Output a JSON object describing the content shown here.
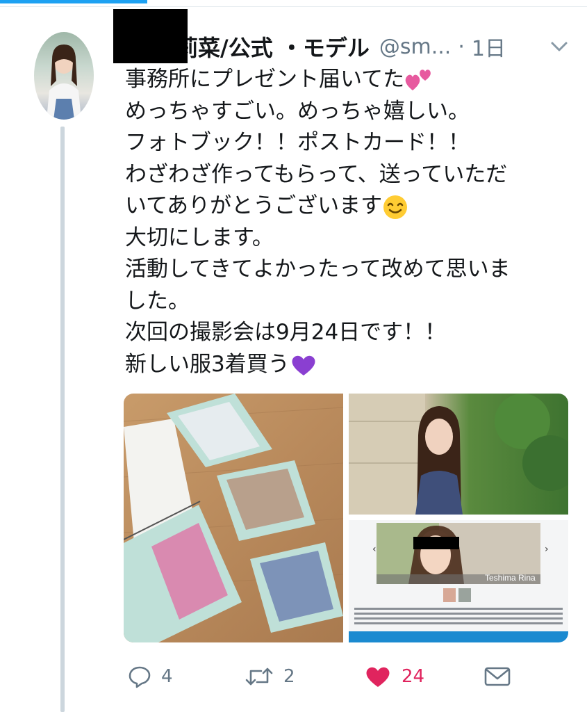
{
  "tweet": {
    "display_name": "莉菜/公式 ・モデル",
    "handle": "@sm...",
    "separator": "·",
    "time": "1日",
    "text_lines": [
      "事務所にプレゼント届いてた",
      "めっちゃすごい。めっちゃ嬉しい。",
      "フォトブック！！ポストカード！！",
      "わざわざ作ってもらって、送っていただ",
      "いてありがとうございます",
      "大切にします。",
      "活動してきてよかったって改めて思いま",
      "した。",
      "次回の撮影会は9月24日です！！",
      "新しい服3着買う"
    ],
    "emojis": [
      "two-hearts",
      "smiling-face",
      "purple-heart"
    ]
  },
  "photos": {
    "flyer_name": "Teshima Rina"
  },
  "actions": {
    "reply_count": "4",
    "retweet_count": "2",
    "like_count": "24"
  },
  "colors": {
    "accent": "#1da1f2",
    "like": "#e0245e",
    "secondary_text": "#657786",
    "thread_line": "#ccd6dd"
  },
  "icons": [
    "caret-down-icon",
    "reply-icon",
    "retweet-icon",
    "like-icon",
    "message-icon"
  ]
}
